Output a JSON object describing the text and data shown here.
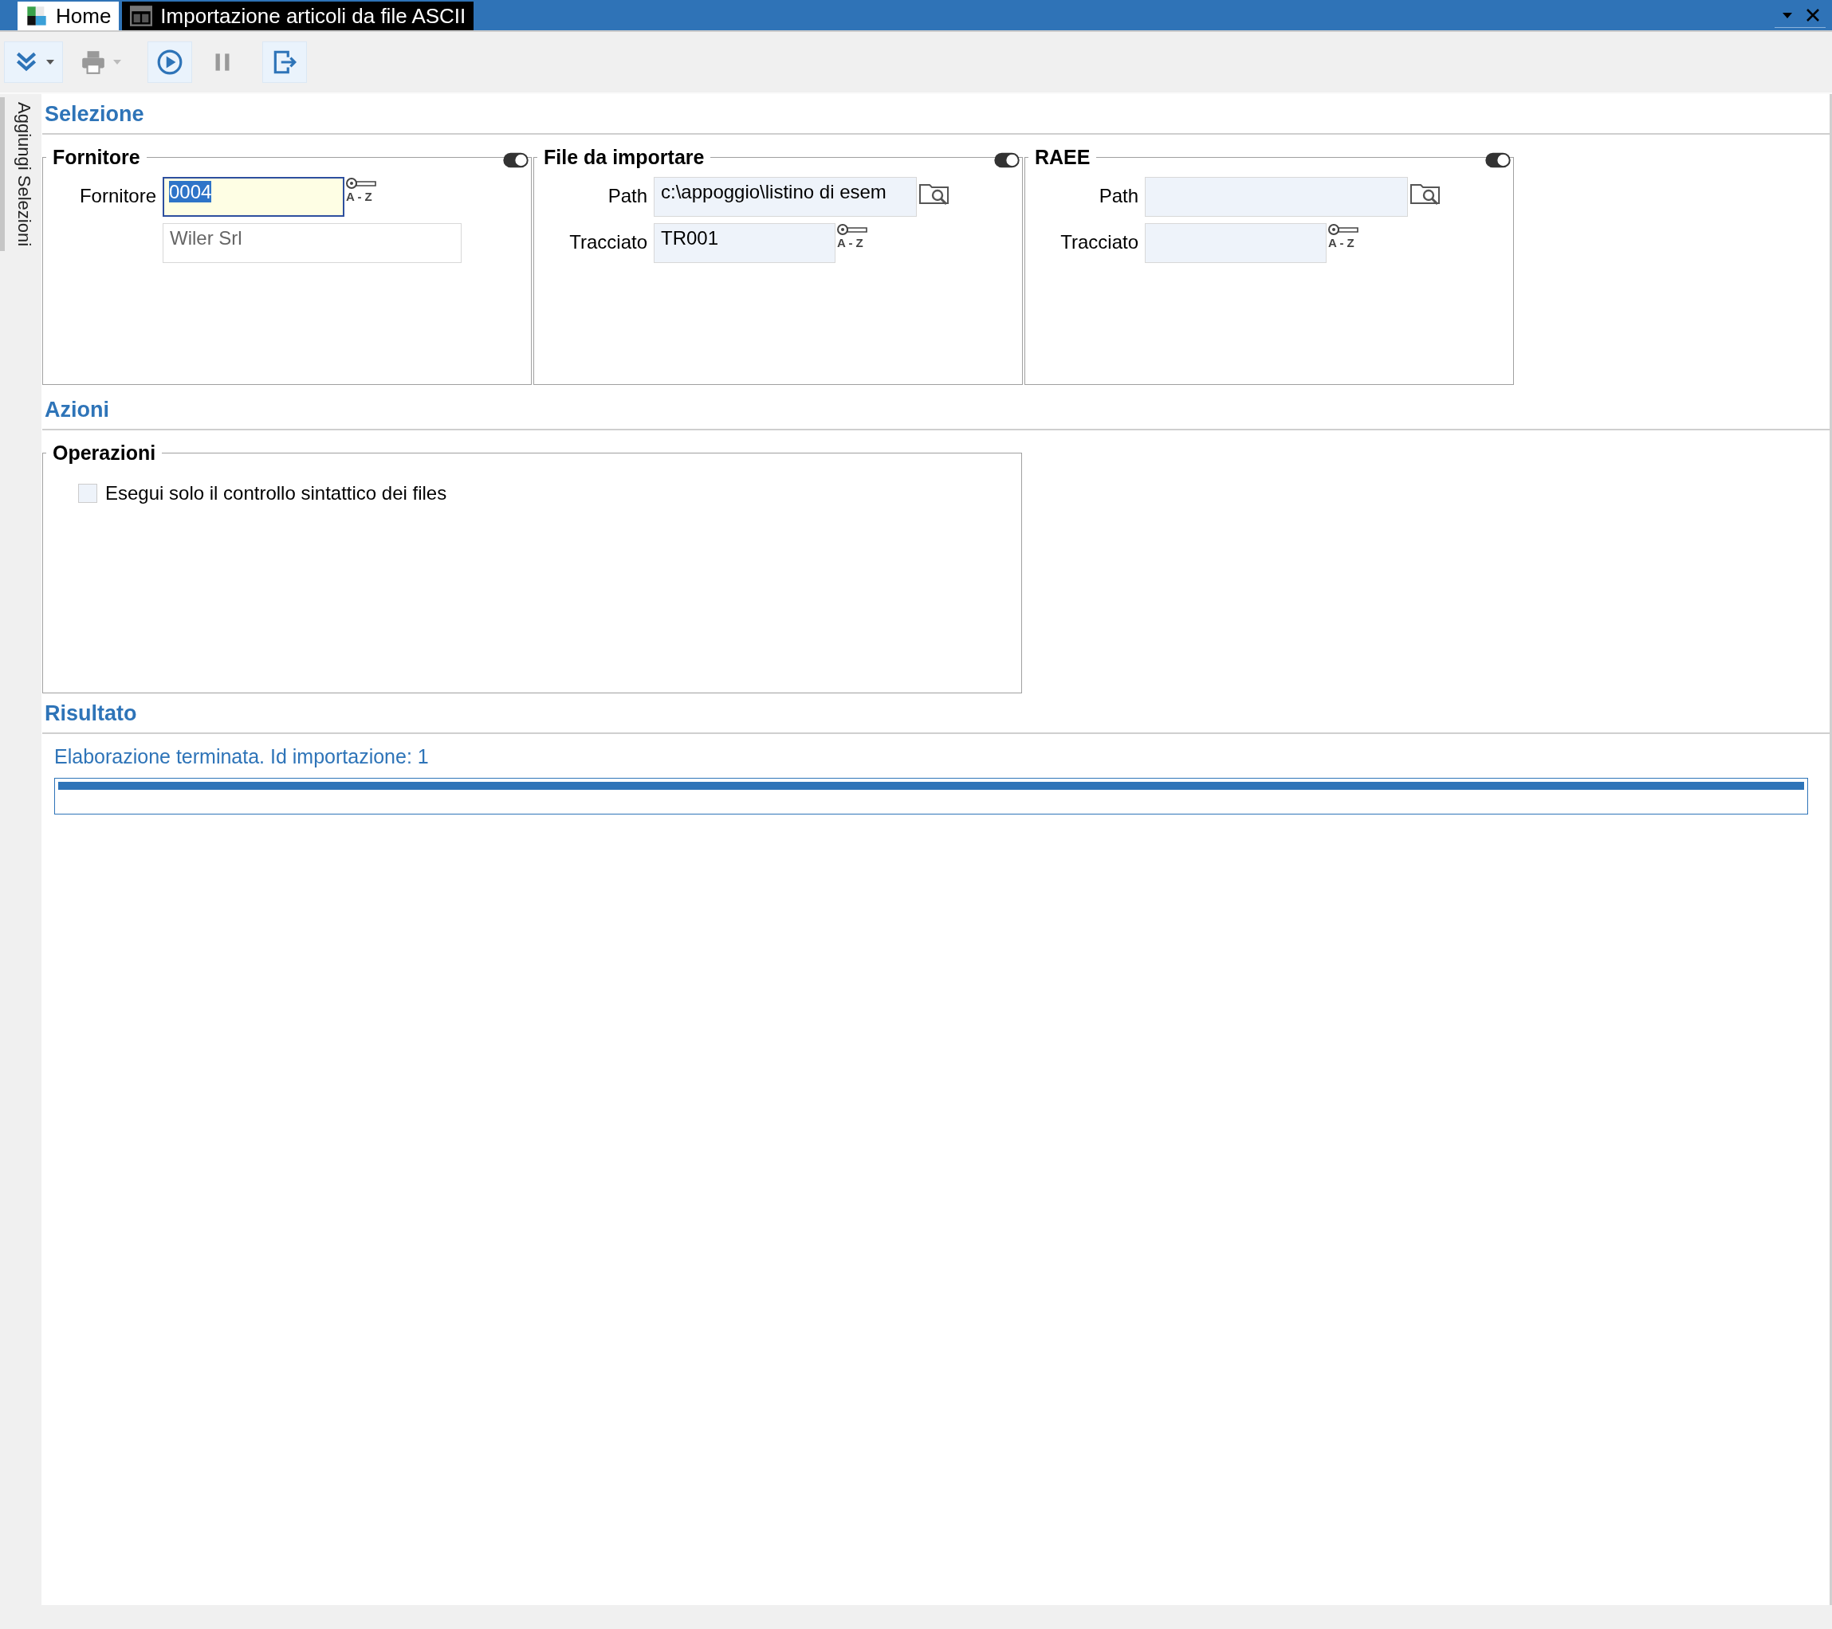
{
  "tabs": [
    {
      "label": "Home",
      "selected": false
    },
    {
      "label": "Importazione articoli da file ASCII",
      "selected": true
    }
  ],
  "window_controls": [
    {
      "kind": "menu"
    },
    {
      "kind": "close"
    }
  ],
  "toolbar": [
    {
      "kind": "expand",
      "dropdown": true,
      "disabled": false
    },
    {
      "kind": "print",
      "dropdown": true,
      "disabled": true
    },
    {
      "kind": "run",
      "dropdown": false,
      "disabled": false
    },
    {
      "kind": "pause",
      "dropdown": false,
      "disabled": true
    },
    {
      "kind": "exit",
      "dropdown": false,
      "disabled": false
    }
  ],
  "side_panel": {
    "label": "Aggiungi Selezioni"
  },
  "selezione": {
    "title": "Selezione",
    "groups": [
      {
        "title": "Fornitore",
        "rows": [
          {
            "label": "Fornitore",
            "value": "0004",
            "focused": true,
            "readonly": false,
            "kind": "key",
            "hint": "A - Z"
          },
          {
            "value": "Wiler Srl",
            "focused": false,
            "readonly": true,
            "kind": "plain"
          }
        ]
      },
      {
        "title": "File da importare",
        "rows": [
          {
            "label": "Path",
            "value": "c:\\appoggio\\listino di esem",
            "focused": false,
            "readonly": false,
            "kind": "folder"
          },
          {
            "label": "Tracciato",
            "value": "TR001",
            "focused": false,
            "readonly": false,
            "kind": "key",
            "hint": "A - Z"
          }
        ]
      },
      {
        "title": "RAEE",
        "rows": [
          {
            "label": "Path",
            "focused": false,
            "readonly": false,
            "kind": "folder"
          },
          {
            "label": "Tracciato",
            "focused": false,
            "readonly": false,
            "kind": "key",
            "hint": "A - Z"
          }
        ]
      }
    ]
  },
  "azioni": {
    "title": "Azioni",
    "groups": [
      {
        "title": "Operazioni",
        "options": [
          {
            "label": "Esegui solo il controllo sintattico dei files",
            "checked": false
          }
        ]
      }
    ]
  },
  "risultato": {
    "title": "Risultato",
    "message": "Elaborazione terminata. Id importazione: 1",
    "progress": {
      "level": 1
    }
  }
}
